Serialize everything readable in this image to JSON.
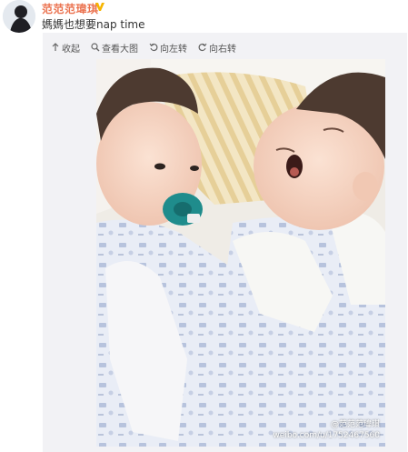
{
  "post": {
    "username": "范范范瑋琪",
    "text": "媽媽也想要nap time",
    "verified_icon": "verified-v-badge"
  },
  "toolbar": {
    "collect_label": "收起",
    "view_large_label": "查看大图",
    "rotate_left_label": "向左转",
    "rotate_right_label": "向右转"
  },
  "photo": {
    "watermark_name": "@范范范瑋琪",
    "watermark_url": "weibo.com/u/1752467560"
  },
  "colors": {
    "username": "#eb7350",
    "badge": "#f7b500",
    "panel": "#f2f2f5"
  }
}
